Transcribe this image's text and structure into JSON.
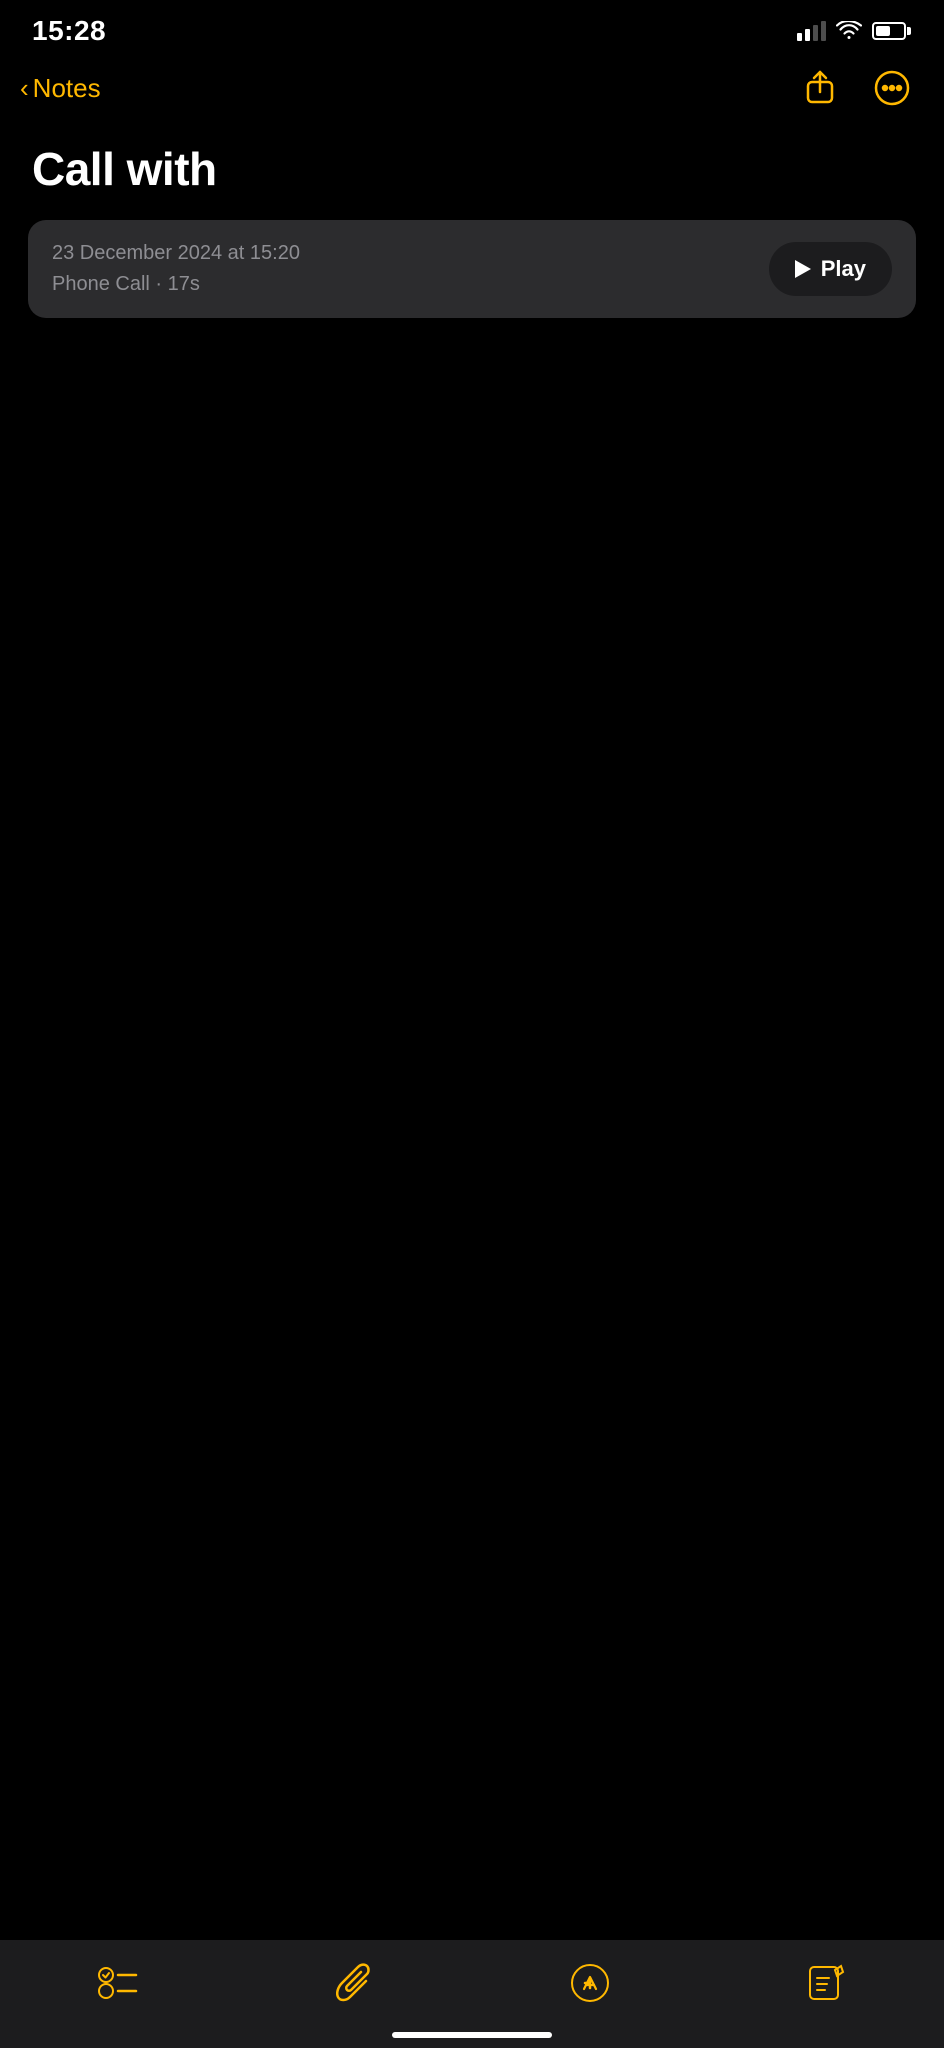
{
  "statusBar": {
    "time": "15:28",
    "signalBars": 2,
    "wifiOn": true,
    "batteryPercent": 45
  },
  "navBar": {
    "backLabel": "Notes",
    "shareIconName": "share-icon",
    "moreIconName": "more-icon"
  },
  "note": {
    "title": "Call with",
    "audioCard": {
      "date": "23 December 2024 at 15:20",
      "type": "Phone Call · 17s",
      "playLabel": "Play"
    }
  },
  "toolbar": {
    "checklistIconName": "checklist-icon",
    "attachIconName": "attach-icon",
    "composeIconName": "compose-icon",
    "newNoteIconName": "new-note-icon"
  }
}
